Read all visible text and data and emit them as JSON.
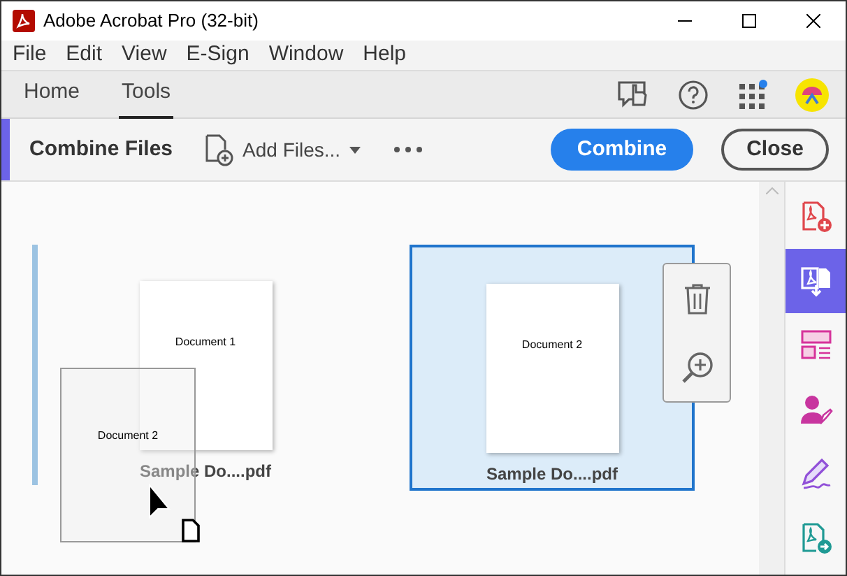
{
  "window": {
    "title": "Adobe Acrobat Pro (32-bit)"
  },
  "menu": [
    "File",
    "Edit",
    "View",
    "E-Sign",
    "Window",
    "Help"
  ],
  "tabs": [
    {
      "label": "Home",
      "selected": false
    },
    {
      "label": "Tools",
      "selected": true
    }
  ],
  "toolbar": {
    "title": "Combine Files",
    "add_files": "Add Files...",
    "combine": "Combine",
    "close": "Close"
  },
  "files": [
    {
      "thumb_text": "Document 1",
      "name": "Sample Do....pdf",
      "selected": false,
      "drop_target": true
    },
    {
      "thumb_text": "Document 2",
      "name": "Sample Do....pdf",
      "selected": true,
      "drop_target": false
    }
  ],
  "drag_ghost": {
    "thumb_text": "Document 2"
  },
  "side_tools": [
    {
      "selected": false
    },
    {
      "selected": true
    },
    {
      "selected": false
    },
    {
      "selected": false
    },
    {
      "selected": false
    },
    {
      "selected": false
    }
  ]
}
